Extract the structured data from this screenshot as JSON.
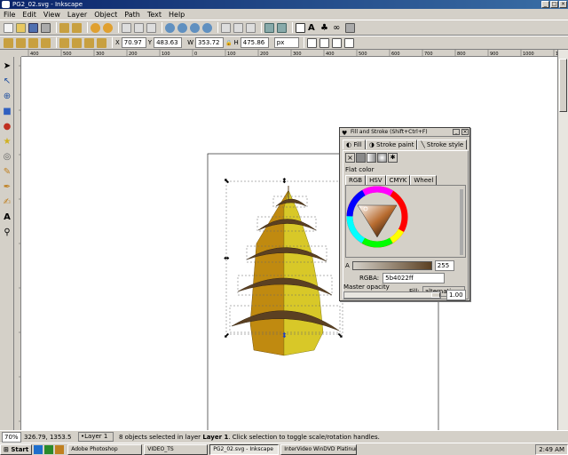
{
  "window": {
    "title": "PG2_02.svg - Inkscape"
  },
  "menu": [
    "File",
    "Edit",
    "View",
    "Layer",
    "Object",
    "Path",
    "Text",
    "Help"
  ],
  "select_bar": {
    "x_label": "X",
    "x_value": "70.97",
    "y_label": "Y",
    "y_value": "483.63",
    "w_label": "W",
    "w_value": "353.72",
    "h_label": "H",
    "h_value": "475.86",
    "unit": "px"
  },
  "ruler_ticks": [
    "400",
    "500",
    "300",
    "200",
    "100",
    "0",
    "100",
    "200",
    "300",
    "400",
    "500",
    "600",
    "700",
    "800",
    "900",
    "1000",
    "1100"
  ],
  "dialog": {
    "title": "Fill and Stroke (Shift+Ctrl+F)",
    "tabs": [
      "Fill",
      "Stroke paint",
      "Stroke style"
    ],
    "flat_color_label": "Flat color",
    "mode_tabs": [
      "RGB",
      "HSV",
      "CMYK",
      "Wheel"
    ],
    "alpha_label": "A",
    "alpha_value": "255",
    "rgba_label": "RGBA:",
    "rgba_value": "5b4022ff",
    "fill_label": "Fill:",
    "fill_rule": "alternating",
    "opacity_label": "Master opacity",
    "opacity_value": "1.00"
  },
  "status": {
    "zoom": "70%",
    "coords": "326.79, 1353.5",
    "layer": "•Layer 1",
    "message_pre": "8 objects selected in layer",
    "message_layer": "Layer 1",
    "message_post": ". Click selection to toggle scale/rotation handles."
  },
  "taskbar": {
    "start": "Start",
    "items": [
      "Adobe Photoshop",
      "VIDEO_TS",
      "PG2_02.svg - Inkscape",
      "InterVideo WinDVD Platinum"
    ],
    "clock": "2:49 AM"
  },
  "colors": {
    "title": "#0a246a",
    "fill_current": "#5b4022",
    "cone_left": "#c08a10",
    "cone_right": "#d8c828",
    "ring": "#5b4022"
  }
}
